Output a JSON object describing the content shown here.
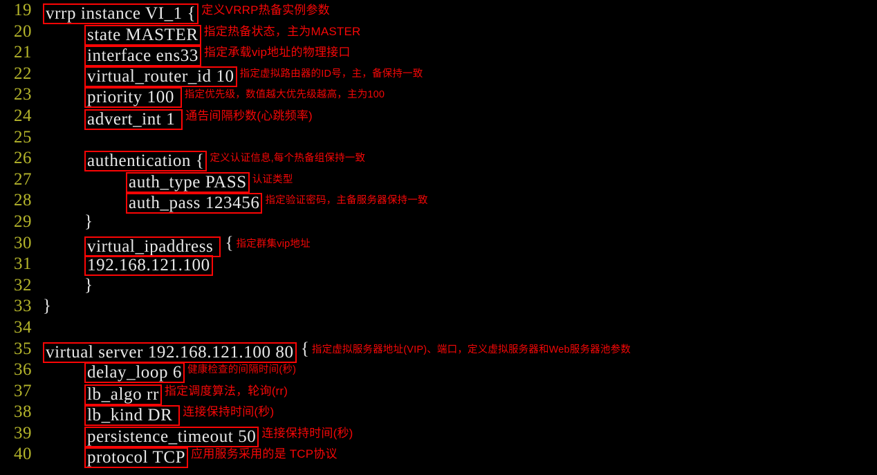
{
  "theme": {
    "background": "#000000",
    "code_color": "#e8e8e8",
    "line_number_color": "#b5b52b",
    "highlight_box_color": "#fc0505",
    "annotation_color": "#f50707"
  },
  "editor": {
    "first_line_number": 19,
    "lines": [
      {
        "number": "19",
        "indent": 0,
        "boxed": "vrrp instance VI_1 {",
        "tail": "",
        "note": "定义VRRP热备实例参数",
        "note_size": "big"
      },
      {
        "number": "20",
        "indent": 1,
        "boxed": "state MASTER",
        "tail": "",
        "note": "指定热备状态，主为MASTER",
        "note_size": "big"
      },
      {
        "number": "21",
        "indent": 1,
        "boxed": "interface ens33",
        "tail": "",
        "note": "指定承载vip地址的物理接口",
        "note_size": "big"
      },
      {
        "number": "22",
        "indent": 1,
        "boxed": "virtual_router_id 10",
        "tail": "",
        "note": "指定虚拟路由器的ID号，主，备保持一致",
        "note_size": "sm"
      },
      {
        "number": "23",
        "indent": 1,
        "boxed": "priority 100 ",
        "tail": "",
        "note": "指定优先级，数值越大优先级越高，主为100",
        "note_size": "sm"
      },
      {
        "number": "24",
        "indent": 1,
        "boxed": "advert_int 1 ",
        "tail": "",
        "note": "通告间隔秒数(心跳频率)",
        "note_size": "big"
      },
      {
        "number": "25",
        "indent": 0,
        "boxed": "",
        "tail": "",
        "note": "",
        "note_size": "big"
      },
      {
        "number": "26",
        "indent": 1,
        "boxed": "authentication {",
        "tail": "",
        "note": "定义认证信息,每个热备组保持一致",
        "note_size": "sm"
      },
      {
        "number": "27",
        "indent": 2,
        "boxed": "auth_type PASS",
        "tail": "",
        "note": "认证类型",
        "note_size": "sm"
      },
      {
        "number": "28",
        "indent": 2,
        "boxed": "auth_pass 123456",
        "tail": "",
        "note": "指定验证密码，主备服务器保持一致",
        "note_size": "sm"
      },
      {
        "number": "29",
        "indent": 1,
        "boxed": "",
        "tail": "}",
        "note": "",
        "note_size": "sm"
      },
      {
        "number": "30",
        "indent": 1,
        "boxed": "virtual_ipaddress ",
        "tail": " {",
        "note": "指定群集vip地址",
        "note_size": "sm"
      },
      {
        "number": "31",
        "indent": 1,
        "boxed": "192.168.121.100",
        "tail": "",
        "note": "",
        "note_size": "sm"
      },
      {
        "number": "32",
        "indent": 1,
        "boxed": "",
        "tail": "}",
        "note": "",
        "note_size": "sm"
      },
      {
        "number": "33",
        "indent": 0,
        "boxed": "",
        "tail": "}",
        "note": "",
        "note_size": "sm"
      },
      {
        "number": "34",
        "indent": 0,
        "boxed": "",
        "tail": "",
        "note": "",
        "note_size": "sm"
      },
      {
        "number": "35",
        "indent": 0,
        "boxed": "virtual server 192.168.121.100 80",
        "tail": " {",
        "note": "指定虚拟服务器地址(VIP)、端口，定义虚拟服务器和Web服务器池参数",
        "note_size": "sm"
      },
      {
        "number": "36",
        "indent": 1,
        "boxed": "delay_loop 6",
        "tail": "",
        "note": "健康检查的间隔时间(秒)",
        "note_size": "sm"
      },
      {
        "number": "37",
        "indent": 1,
        "boxed": "lb_algo rr",
        "tail": "",
        "note": "指定调度算法，轮询(rr)",
        "note_size": "big"
      },
      {
        "number": "38",
        "indent": 1,
        "boxed": "lb_kind DR ",
        "tail": "",
        "note": "连接保持时间(秒)",
        "note_size": "big"
      },
      {
        "number": "39",
        "indent": 1,
        "boxed": "persistence_timeout 50",
        "tail": "",
        "note": "连接保持时间(秒)",
        "note_size": "big"
      },
      {
        "number": "40",
        "indent": 1,
        "boxed": "protocol TCP",
        "tail": "",
        "note": "应用服务采用的是 TCP协议",
        "note_size": "big"
      }
    ]
  }
}
